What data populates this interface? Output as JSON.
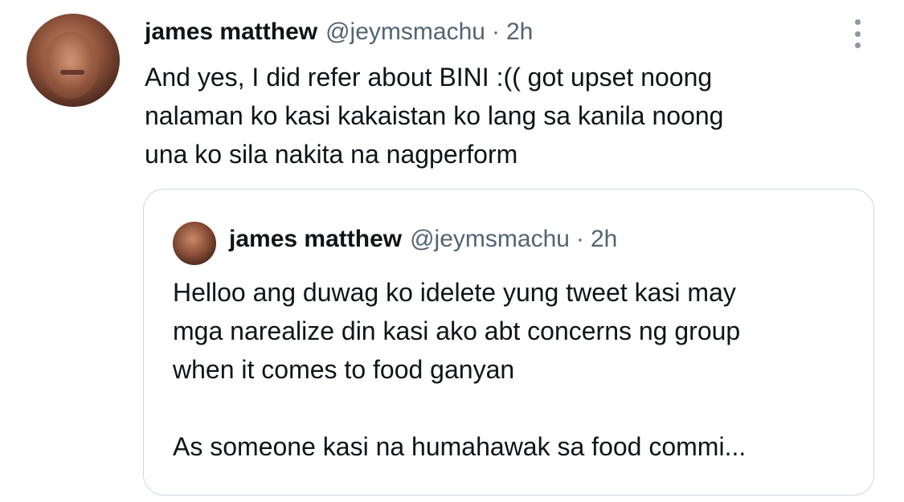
{
  "tweet": {
    "author": {
      "name": "james matthew",
      "handle": "@jeymsmachu",
      "separator": "·",
      "time": "2h"
    },
    "text": "And yes, I did refer about BINI :(( got upset noong\nnalaman ko kasi kakaistan ko lang sa kanila noong\nuna ko sila nakita na nagperform",
    "more_icon": "more-vertical-icon"
  },
  "quoted_tweet": {
    "author": {
      "name": "james matthew",
      "handle": "@jeymsmachu",
      "separator": "·",
      "time": "2h"
    },
    "text": "Helloo ang duwag ko idelete yung tweet kasi may\nmga narealize din kasi ako abt concerns ng group\nwhen it comes to food ganyan\n\nAs someone kasi na humahawak sa food commi..."
  },
  "colors": {
    "primary_text": "#0f1419",
    "secondary_text": "#536471",
    "border": "#cfd9de",
    "background": "#ffffff"
  }
}
